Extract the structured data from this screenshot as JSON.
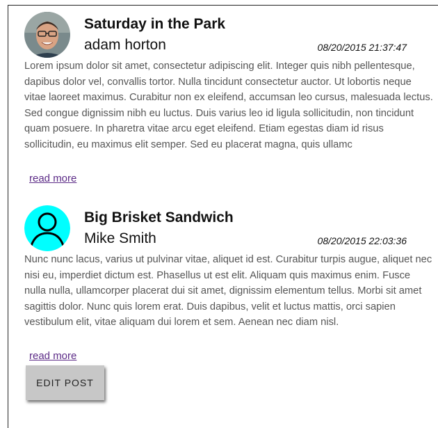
{
  "posts": [
    {
      "title": "Saturday in the Park",
      "author": "adam horton",
      "date": "08/20/2015 21:37:47",
      "body": "Lorem ipsum dolor sit amet, consectetur adipiscing elit. Integer quis nibh pellentesque, dapibus dolor vel, convallis tortor. Nulla tincidunt consectetur auctor. Ut lobortis neque vitae laoreet maximus. Curabitur non ex eleifend, accumsan leo cursus, malesuada lectus. Sed congue dignissim nibh eu luctus. Duis varius leo id ligula sollicitudin, non tincidunt quam posuere. In pharetra vitae arcu eget eleifend. Etiam egestas diam id risus sollicitudin, eu maximus elit semper. Sed eu placerat magna, quis ullamc",
      "read_more": "read more",
      "avatar_icon": "user-photo-icon"
    },
    {
      "title": "Big Brisket Sandwich",
      "author": "Mike Smith",
      "date": "08/20/2015 22:03:36",
      "body": "Nunc nunc lacus, varius ut pulvinar vitae, aliquet id est. Curabitur turpis augue, aliquet nec nisi eu, imperdiet dictum est. Phasellus ut est elit. Aliquam quis maximus enim. Fusce nulla nulla, ullamcorper placerat dui sit amet, dignissim elementum tellus. Morbi sit amet sagittis dolor. Nunc quis lorem erat. Duis dapibus, velit et luctus mattis, orci sapien vestibulum elit, vitae aliquam dui lorem et sem. Aenean nec diam nisl.",
      "read_more": "read more",
      "avatar_icon": "default-user-icon",
      "avatar_color": "#00ffff"
    }
  ],
  "edit_button": "EDIT POST",
  "colors": {
    "link": "#5b2a86",
    "button": "#c7c7c7",
    "body_text": "#555555"
  }
}
